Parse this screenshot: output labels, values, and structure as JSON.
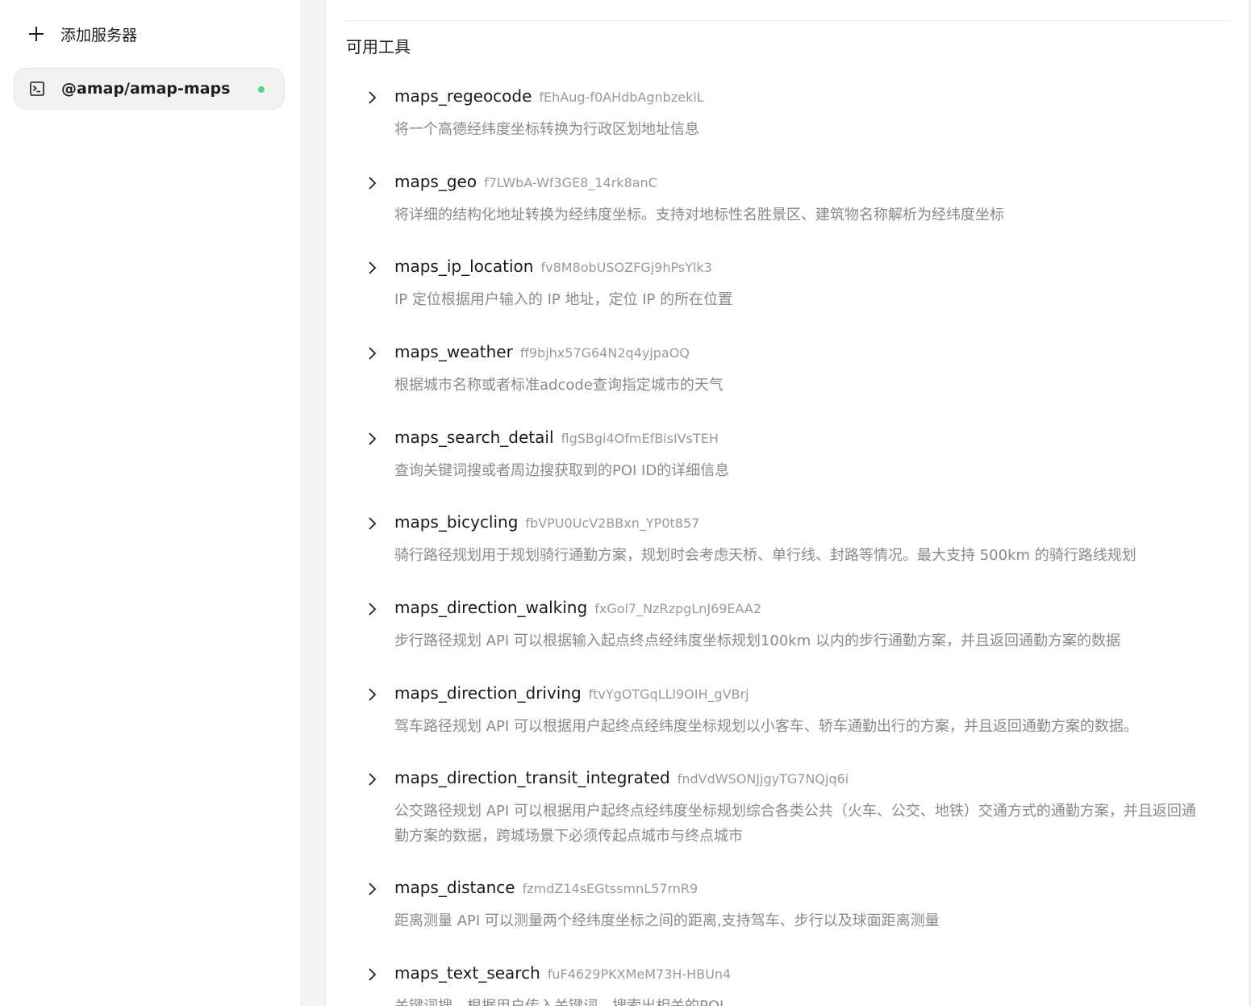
{
  "sidebar": {
    "add_server": {
      "icon": "plus-icon",
      "label": "添加服务器"
    },
    "servers": [
      {
        "icon": "terminal-icon",
        "name": "@amap/amap-maps",
        "status": "online",
        "status_color": "#5bd48a"
      }
    ]
  },
  "main": {
    "section_title": "可用工具",
    "tools": [
      {
        "name": "maps_regeocode",
        "id": "fEhAug-f0AHdbAgnbzekiL",
        "description": "将一个高德经纬度坐标转换为行政区划地址信息"
      },
      {
        "name": "maps_geo",
        "id": "f7LWbA-Wf3GE8_14rk8anC",
        "description": "将详细的结构化地址转换为经纬度坐标。支持对地标性名胜景区、建筑物名称解析为经纬度坐标"
      },
      {
        "name": "maps_ip_location",
        "id": "fv8M8obUSOZFGj9hPsYlk3",
        "description": "IP 定位根据用户输入的 IP 地址，定位 IP 的所在位置"
      },
      {
        "name": "maps_weather",
        "id": "ff9bjhx57G64N2q4yjpaOQ",
        "description": "根据城市名称或者标准adcode查询指定城市的天气"
      },
      {
        "name": "maps_search_detail",
        "id": "flgSBgi4OfmEfBisIVsTEH",
        "description": "查询关键词搜或者周边搜获取到的POI ID的详细信息"
      },
      {
        "name": "maps_bicycling",
        "id": "fbVPU0UcV2BBxn_YP0t857",
        "description": "骑行路径规划用于规划骑行通勤方案，规划时会考虑天桥、单行线、封路等情况。最大支持 500km 的骑行路线规划"
      },
      {
        "name": "maps_direction_walking",
        "id": "fxGol7_NzRzpgLnJ69EAA2",
        "description": "步行路径规划 API 可以根据输入起点终点经纬度坐标规划100km 以内的步行通勤方案，并且返回通勤方案的数据"
      },
      {
        "name": "maps_direction_driving",
        "id": "ftvYgOTGqLLl9OIH_gVBrj",
        "description": "驾车路径规划 API 可以根据用户起终点经纬度坐标规划以小客车、轿车通勤出行的方案，并且返回通勤方案的数据。"
      },
      {
        "name": "maps_direction_transit_integrated",
        "id": "fndVdWSONJjgyTG7NQjq6i",
        "description": "公交路径规划 API 可以根据用户起终点经纬度坐标规划综合各类公共（火车、公交、地铁）交通方式的通勤方案，并且返回通勤方案的数据，跨城场景下必须传起点城市与终点城市"
      },
      {
        "name": "maps_distance",
        "id": "fzmdZ14sEGtssmnL57rnR9",
        "description": "距离测量 API 可以测量两个经纬度坐标之间的距离,支持驾车、步行以及球面距离测量"
      },
      {
        "name": "maps_text_search",
        "id": "fuF4629PKXMeM73H-HBUn4",
        "description": "关键词搜，根据用户传入关键词，搜索出相关的POI"
      }
    ]
  }
}
